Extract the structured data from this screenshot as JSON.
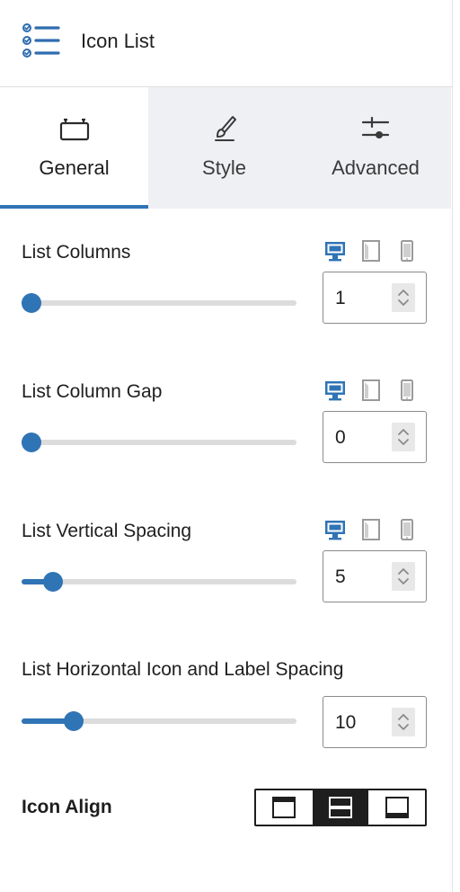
{
  "header": {
    "title": "Icon List",
    "icon": "list-check-icon"
  },
  "tabs": [
    {
      "label": "General",
      "icon": "toolbox-icon",
      "active": true
    },
    {
      "label": "Style",
      "icon": "brush-icon",
      "active": false
    },
    {
      "label": "Advanced",
      "icon": "sliders-icon",
      "active": false
    }
  ],
  "controls": {
    "list_columns": {
      "label": "List Columns",
      "value": "1",
      "slider_fraction": 0.0
    },
    "list_column_gap": {
      "label": "List Column Gap",
      "value": "0",
      "slider_fraction": 0.0
    },
    "list_vertical_spacing": {
      "label": "List Vertical Spacing",
      "value": "5",
      "slider_fraction": 0.083
    },
    "list_horizontal_spacing": {
      "label": "List Horizontal Icon and Label Spacing",
      "value": "10",
      "slider_fraction": 0.167
    }
  },
  "device_toggles": {
    "active": "desktop",
    "options": [
      "desktop",
      "tablet",
      "mobile"
    ]
  },
  "icon_align": {
    "label": "Icon Align",
    "options": [
      "top",
      "middle",
      "bottom"
    ],
    "selected": "middle"
  },
  "colors": {
    "accent": "#2f74b5",
    "dark": "#1e1e1e",
    "track": "#dcdcdc",
    "tab_inactive_bg": "#eef0f3"
  }
}
